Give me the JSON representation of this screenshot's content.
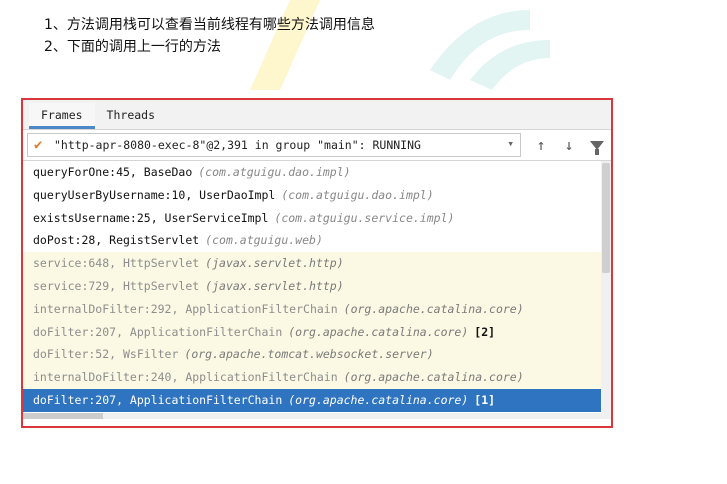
{
  "notes": [
    "1、方法调用栈可以查看当前线程有哪些方法调用信息",
    "2、下面的调用上一行的方法"
  ],
  "tabs": [
    {
      "label": "Frames",
      "active": true
    },
    {
      "label": "Threads",
      "active": false
    }
  ],
  "thread": {
    "label": "\"http-apr-8080-exec-8\"@2,391 in group \"main\": RUNNING",
    "status_icon": "check-icon"
  },
  "toolbar": {
    "up_icon": "↑",
    "down_icon": "↓"
  },
  "frames": [
    {
      "method": "queryForOne:45, BaseDao",
      "package": "(com.atguigu.dao.impl)",
      "mark": "",
      "kind": "app"
    },
    {
      "method": "queryUserByUsername:10, UserDaoImpl",
      "package": "(com.atguigu.dao.impl)",
      "mark": "",
      "kind": "app"
    },
    {
      "method": "existsUsername:25, UserServiceImpl",
      "package": "(com.atguigu.service.impl)",
      "mark": "",
      "kind": "app"
    },
    {
      "method": "doPost:28, RegistServlet",
      "package": "(com.atguigu.web)",
      "mark": "",
      "kind": "app"
    },
    {
      "method": "service:648, HttpServlet",
      "package": "(javax.servlet.http)",
      "mark": "",
      "kind": "lib"
    },
    {
      "method": "service:729, HttpServlet",
      "package": "(javax.servlet.http)",
      "mark": "",
      "kind": "lib"
    },
    {
      "method": "internalDoFilter:292, ApplicationFilterChain",
      "package": "(org.apache.catalina.core)",
      "mark": "",
      "kind": "lib"
    },
    {
      "method": "doFilter:207, ApplicationFilterChain",
      "package": "(org.apache.catalina.core)",
      "mark": "[2]",
      "kind": "lib"
    },
    {
      "method": "doFilter:52, WsFilter",
      "package": "(org.apache.tomcat.websocket.server)",
      "mark": "",
      "kind": "lib"
    },
    {
      "method": "internalDoFilter:240, ApplicationFilterChain",
      "package": "(org.apache.catalina.core)",
      "mark": "",
      "kind": "lib"
    },
    {
      "method": "doFilter:207, ApplicationFilterChain",
      "package": "(org.apache.catalina.core)",
      "mark": "[1]",
      "kind": "selected"
    }
  ],
  "colors": {
    "panel_border": "#d9363e",
    "selected_row": "#2f74c0",
    "library_row": "#fbf9e4",
    "check": "#e07a2e"
  }
}
